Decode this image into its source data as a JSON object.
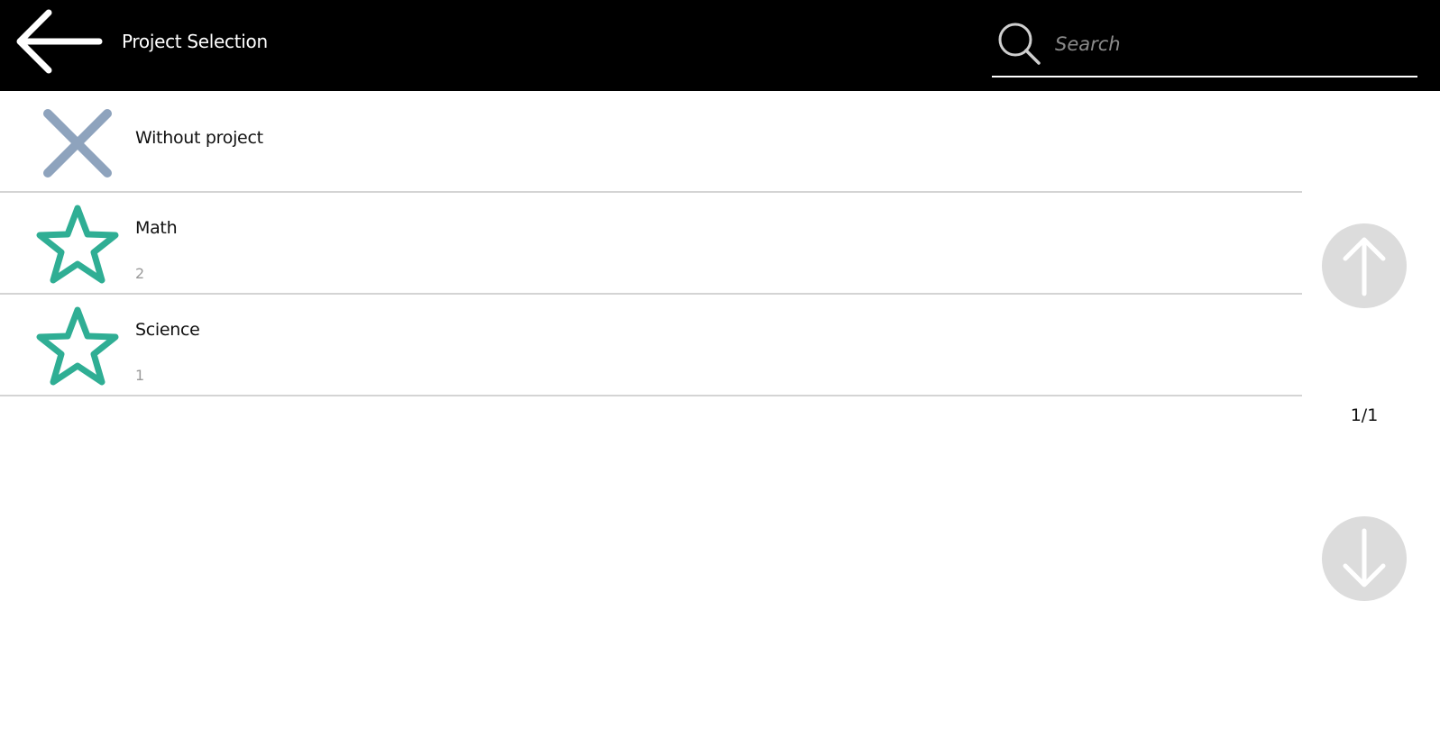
{
  "header": {
    "title": "Project Selection",
    "back_icon": "arrow-left-icon"
  },
  "search": {
    "placeholder": "Search",
    "value": "",
    "icon": "search-icon"
  },
  "projects": [
    {
      "name": "Without project",
      "count": "",
      "icon": "close-x-icon",
      "icon_color": "#8ea3bd"
    },
    {
      "name": "Math",
      "count": "2",
      "icon": "star-icon",
      "icon_color": "#2fae94"
    },
    {
      "name": "Science",
      "count": "1",
      "icon": "star-icon",
      "icon_color": "#2fae94"
    }
  ],
  "pagination": {
    "indicator": "1/1",
    "up_icon": "arrow-up-icon",
    "down_icon": "arrow-down-icon"
  },
  "colors": {
    "header_bg": "#000000",
    "star": "#2fae94",
    "x_mark": "#8ea3bd",
    "nav_button": "#dcdcdc"
  }
}
